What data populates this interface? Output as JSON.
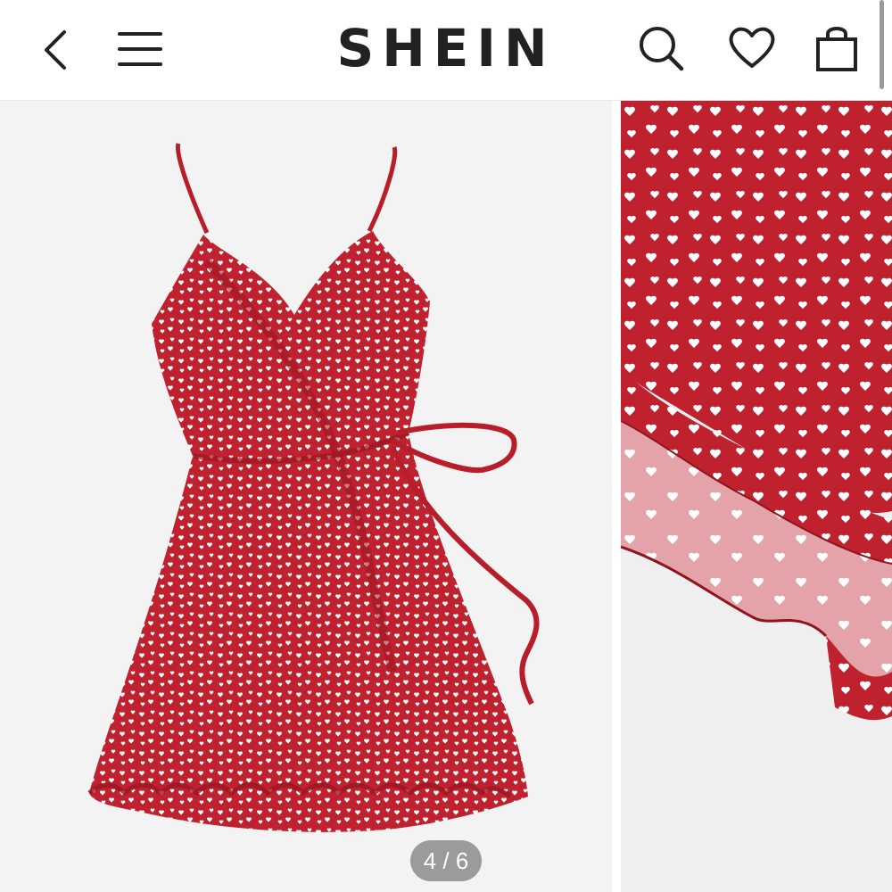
{
  "header": {
    "back_icon": "chevron-left-icon",
    "menu_icon": "hamburger-menu-icon",
    "logo_text": "SHEIN",
    "search_icon": "search-icon",
    "wishlist_icon": "heart-icon",
    "bag_icon": "shopping-bag-icon"
  },
  "gallery": {
    "counter": "4 / 6",
    "current_index": 4,
    "total": 6,
    "colors": {
      "dress_red": "#c0212e",
      "dress_dark": "#9a1722",
      "lining_pink": "#e8a9ad",
      "print_white": "#ffffff"
    }
  }
}
